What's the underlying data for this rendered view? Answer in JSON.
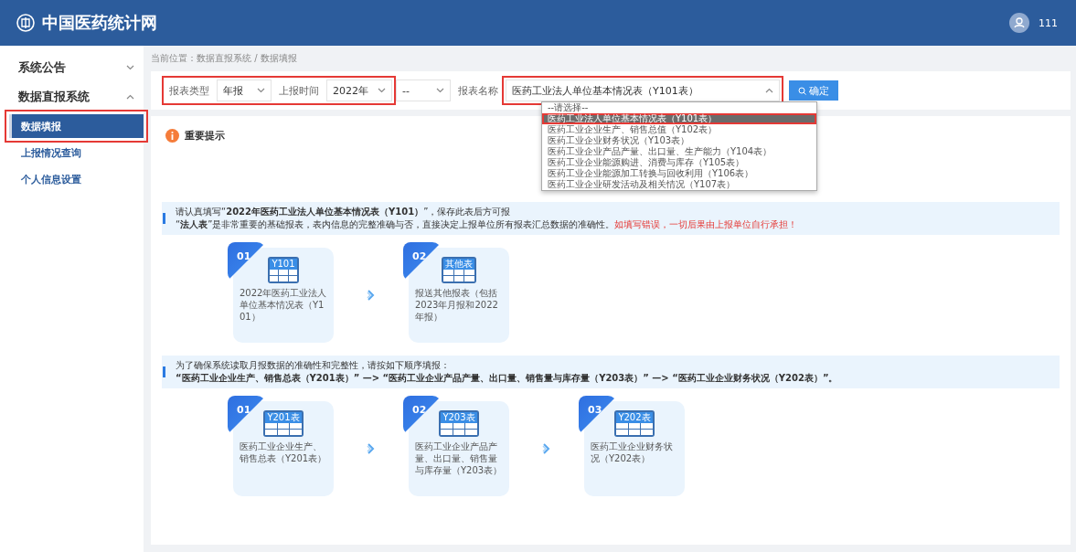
{
  "header": {
    "site_title": "中国医药统计网",
    "user_name": "111"
  },
  "sidebar": {
    "items": [
      {
        "label": "系统公告",
        "expanded": false
      },
      {
        "label": "数据直报系统",
        "expanded": true,
        "children": [
          {
            "label": "数据填报",
            "selected": true,
            "highlighted": true
          },
          {
            "label": "上报情况查询",
            "selected": false,
            "highlighted": false
          },
          {
            "label": "个人信息设置",
            "selected": false,
            "highlighted": false
          }
        ]
      }
    ]
  },
  "breadcrumb": "当前位置：数据直报系统 / 数据填报",
  "filter": {
    "fields": [
      {
        "label": "报表类型",
        "value": "年报",
        "highlighted": true
      },
      {
        "label": "上报时间",
        "value": "2022年",
        "highlighted": true
      },
      {
        "value": "--",
        "highlighted": false
      },
      {
        "label": "报表名称",
        "value": "医药工业法人单位基本情况表（Y101表）",
        "highlighted": true
      }
    ],
    "button": "确定",
    "dropdown": {
      "options": [
        {
          "label": "--请选择--",
          "selected": false
        },
        {
          "label": "医药工业法人单位基本情况表（Y101表）",
          "selected": true
        },
        {
          "label": "医药工业企业生产、销售总值（Y102表）",
          "selected": false
        },
        {
          "label": "医药工业企业财务状况（Y103表）",
          "selected": false
        },
        {
          "label": "医药工业企业产品产量、出口量、生产能力（Y104表）",
          "selected": false
        },
        {
          "label": "医药工业企业能源购进、消费与库存（Y105表）",
          "selected": false
        },
        {
          "label": "医药工业企业能源加工转换与回收利用（Y106表）",
          "selected": false
        },
        {
          "label": "医药工业企业研发活动及相关情况（Y107表）",
          "selected": false
        }
      ]
    }
  },
  "notice_title": "重要提示",
  "sections": [
    {
      "lines": [
        {
          "text": "请认真填写“**2022年医药工业法人单位基本情况表（Y101）**”，保存此表后方可报"
        },
        {
          "text": "“**法人表**”是非常重要的基础报表，表内信息的完整准确与否，直接决定上报单位所有报表汇总数据的准确性。",
          "warning": "如填写错误，一切后果由上报单位自行承担！"
        }
      ],
      "steps": [
        {
          "number": "01",
          "icon_label": "Y101",
          "text": "2022年医药工业法人单位基本情况表（Y101）"
        },
        {
          "number": "02",
          "icon_label": "其他表",
          "text": "报送其他报表（包括2023年月报和2022年报）"
        }
      ]
    },
    {
      "lines": [
        {
          "text": "为了确保系统读取月报数据的准确性和完整性，请按如下顺序填报："
        },
        {
          "text": "**“医药工业企业生产、销售总表（Y201表）” —> “医药工业企业产品产量、出口量、销售量与库存量（Y203表）” —> “医药工业企业财务状况（Y202表）”。**"
        }
      ],
      "steps": [
        {
          "number": "01",
          "icon_label": "Y201表",
          "text": "医药工业企业生产、销售总表（Y201表）"
        },
        {
          "number": "02",
          "icon_label": "Y203表",
          "text": "医药工业企业产品产量、出口量、销售量与库存量（Y203表）"
        },
        {
          "number": "03",
          "icon_label": "Y202表",
          "text": "医药工业企业财务状况（Y202表）"
        }
      ]
    }
  ]
}
